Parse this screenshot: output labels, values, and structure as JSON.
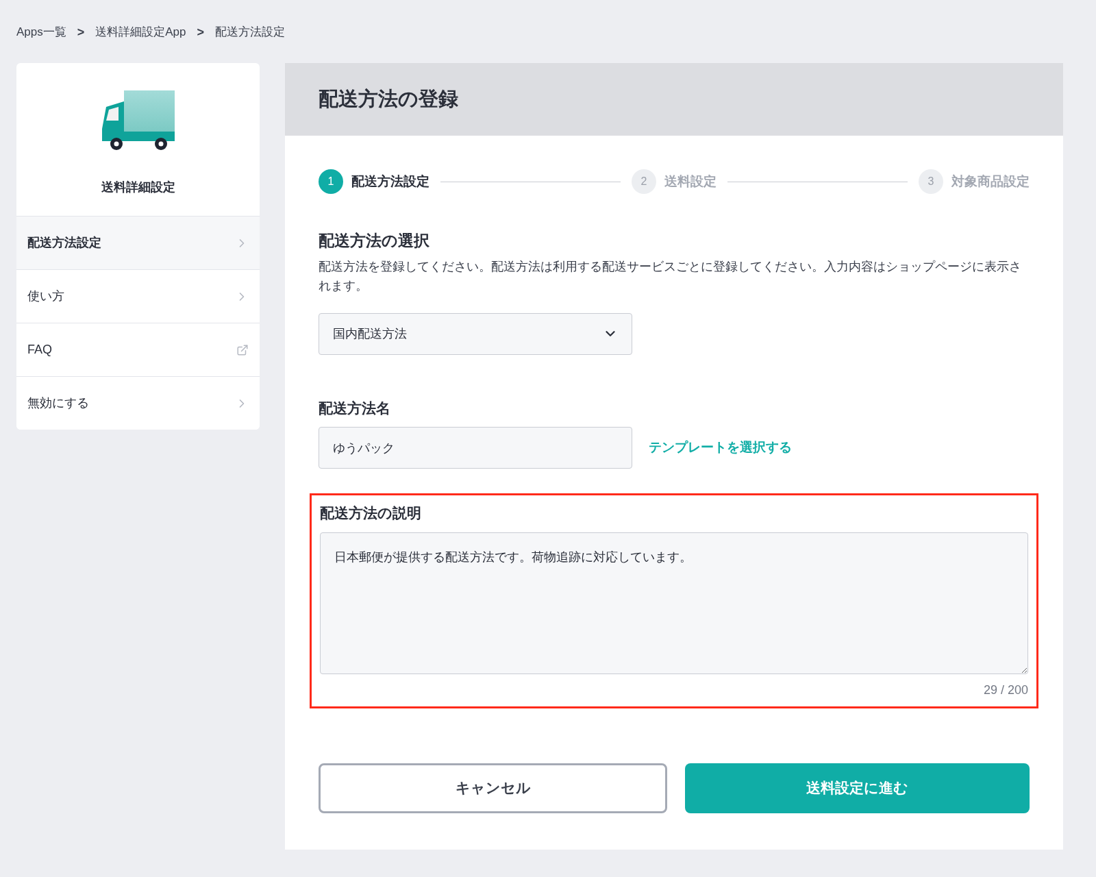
{
  "breadcrumb": [
    {
      "label": "Apps一覧",
      "separator": ">"
    },
    {
      "label": "送料詳細設定App",
      "separator": ">"
    },
    {
      "label": "配送方法設定"
    }
  ],
  "sidebar": {
    "app_name": "送料詳細設定",
    "items": [
      {
        "label": "配送方法設定",
        "selected": true,
        "kind": "chevron"
      },
      {
        "label": "使い方",
        "selected": false,
        "kind": "chevron"
      },
      {
        "label": "FAQ",
        "selected": false,
        "kind": "external"
      },
      {
        "label": "無効にする",
        "selected": false,
        "kind": "chevron"
      }
    ]
  },
  "panel": {
    "title": "配送方法の登録",
    "steps": [
      {
        "number": "1",
        "label": "配送方法設定",
        "selected": true
      },
      {
        "number": "2",
        "label": "送料設定",
        "selected": false
      },
      {
        "number": "3",
        "label": "対象商品設定",
        "selected": false
      }
    ],
    "method_select": {
      "heading": "配送方法の選択",
      "description": "配送方法を登録してください。配送方法は利用する配送サービスごとに登録してください。入力内容はショップページに表示されます。",
      "value": "国内配送方法"
    },
    "method_name": {
      "heading": "配送方法名",
      "value": "ゆうパック",
      "link": "テンプレートを選択する"
    },
    "method_description": {
      "heading": "配送方法の説明",
      "value": "日本郵便が提供する配送方法です。荷物追跡に対応しています。",
      "counter": "29 / 200",
      "highlighted": true
    },
    "buttons": [
      {
        "label": "キャンセル",
        "kind": "secondary"
      },
      {
        "label": "送料設定に進む",
        "kind": "primary"
      }
    ]
  }
}
